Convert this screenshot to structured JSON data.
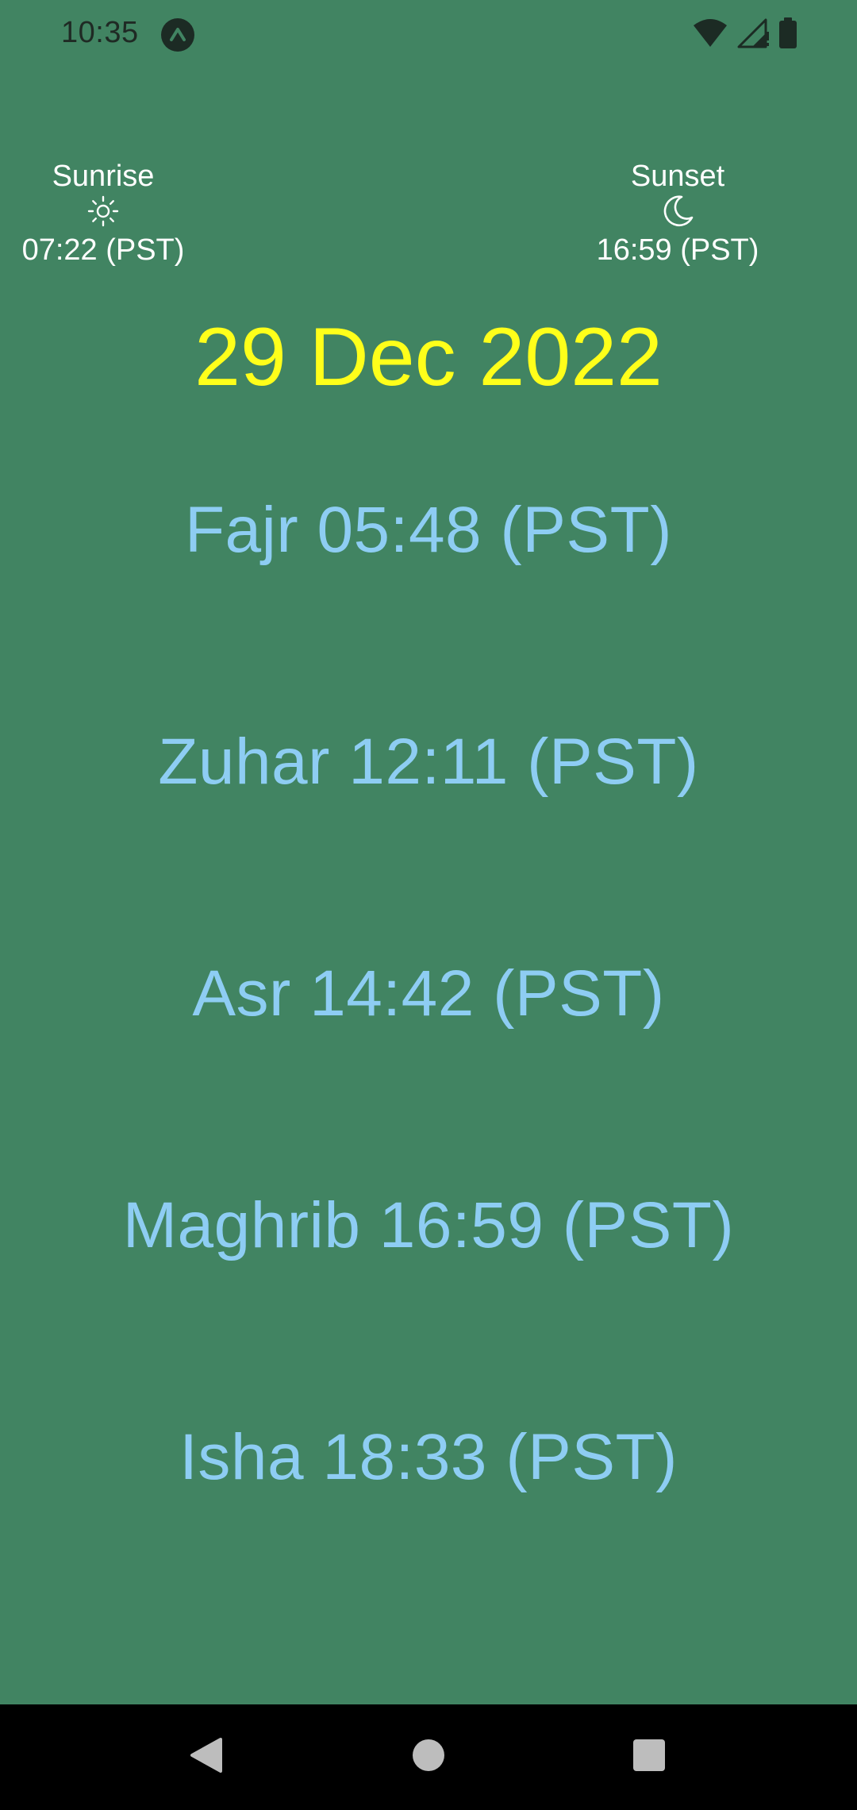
{
  "status_bar": {
    "time": "10:35",
    "app_icon": "a-circle-icon",
    "wifi_icon": "wifi-icon",
    "signal_icon": "cell-signal-icon",
    "battery_icon": "battery-icon"
  },
  "sunrise": {
    "label": "Sunrise",
    "icon": "sun-icon",
    "time": "07:22 (PST)"
  },
  "sunset": {
    "label": "Sunset",
    "icon": "moon-icon",
    "time": "16:59 (PST)"
  },
  "date": "29 Dec 2022",
  "prayers": [
    {
      "text": "Fajr 05:48 (PST)"
    },
    {
      "text": "Zuhar 12:11 (PST)"
    },
    {
      "text": "Asr 14:42 (PST)"
    },
    {
      "text": "Maghrib 16:59 (PST)"
    },
    {
      "text": "Isha 18:33 (PST)"
    }
  ],
  "nav_bar": {
    "back_icon": "back-triangle-icon",
    "home_icon": "home-circle-icon",
    "recents_icon": "recents-square-icon"
  },
  "colors": {
    "background": "#418462",
    "date": "#ffff1a",
    "prayer_text": "#8ecdf3",
    "sun_text": "#ffffff"
  }
}
